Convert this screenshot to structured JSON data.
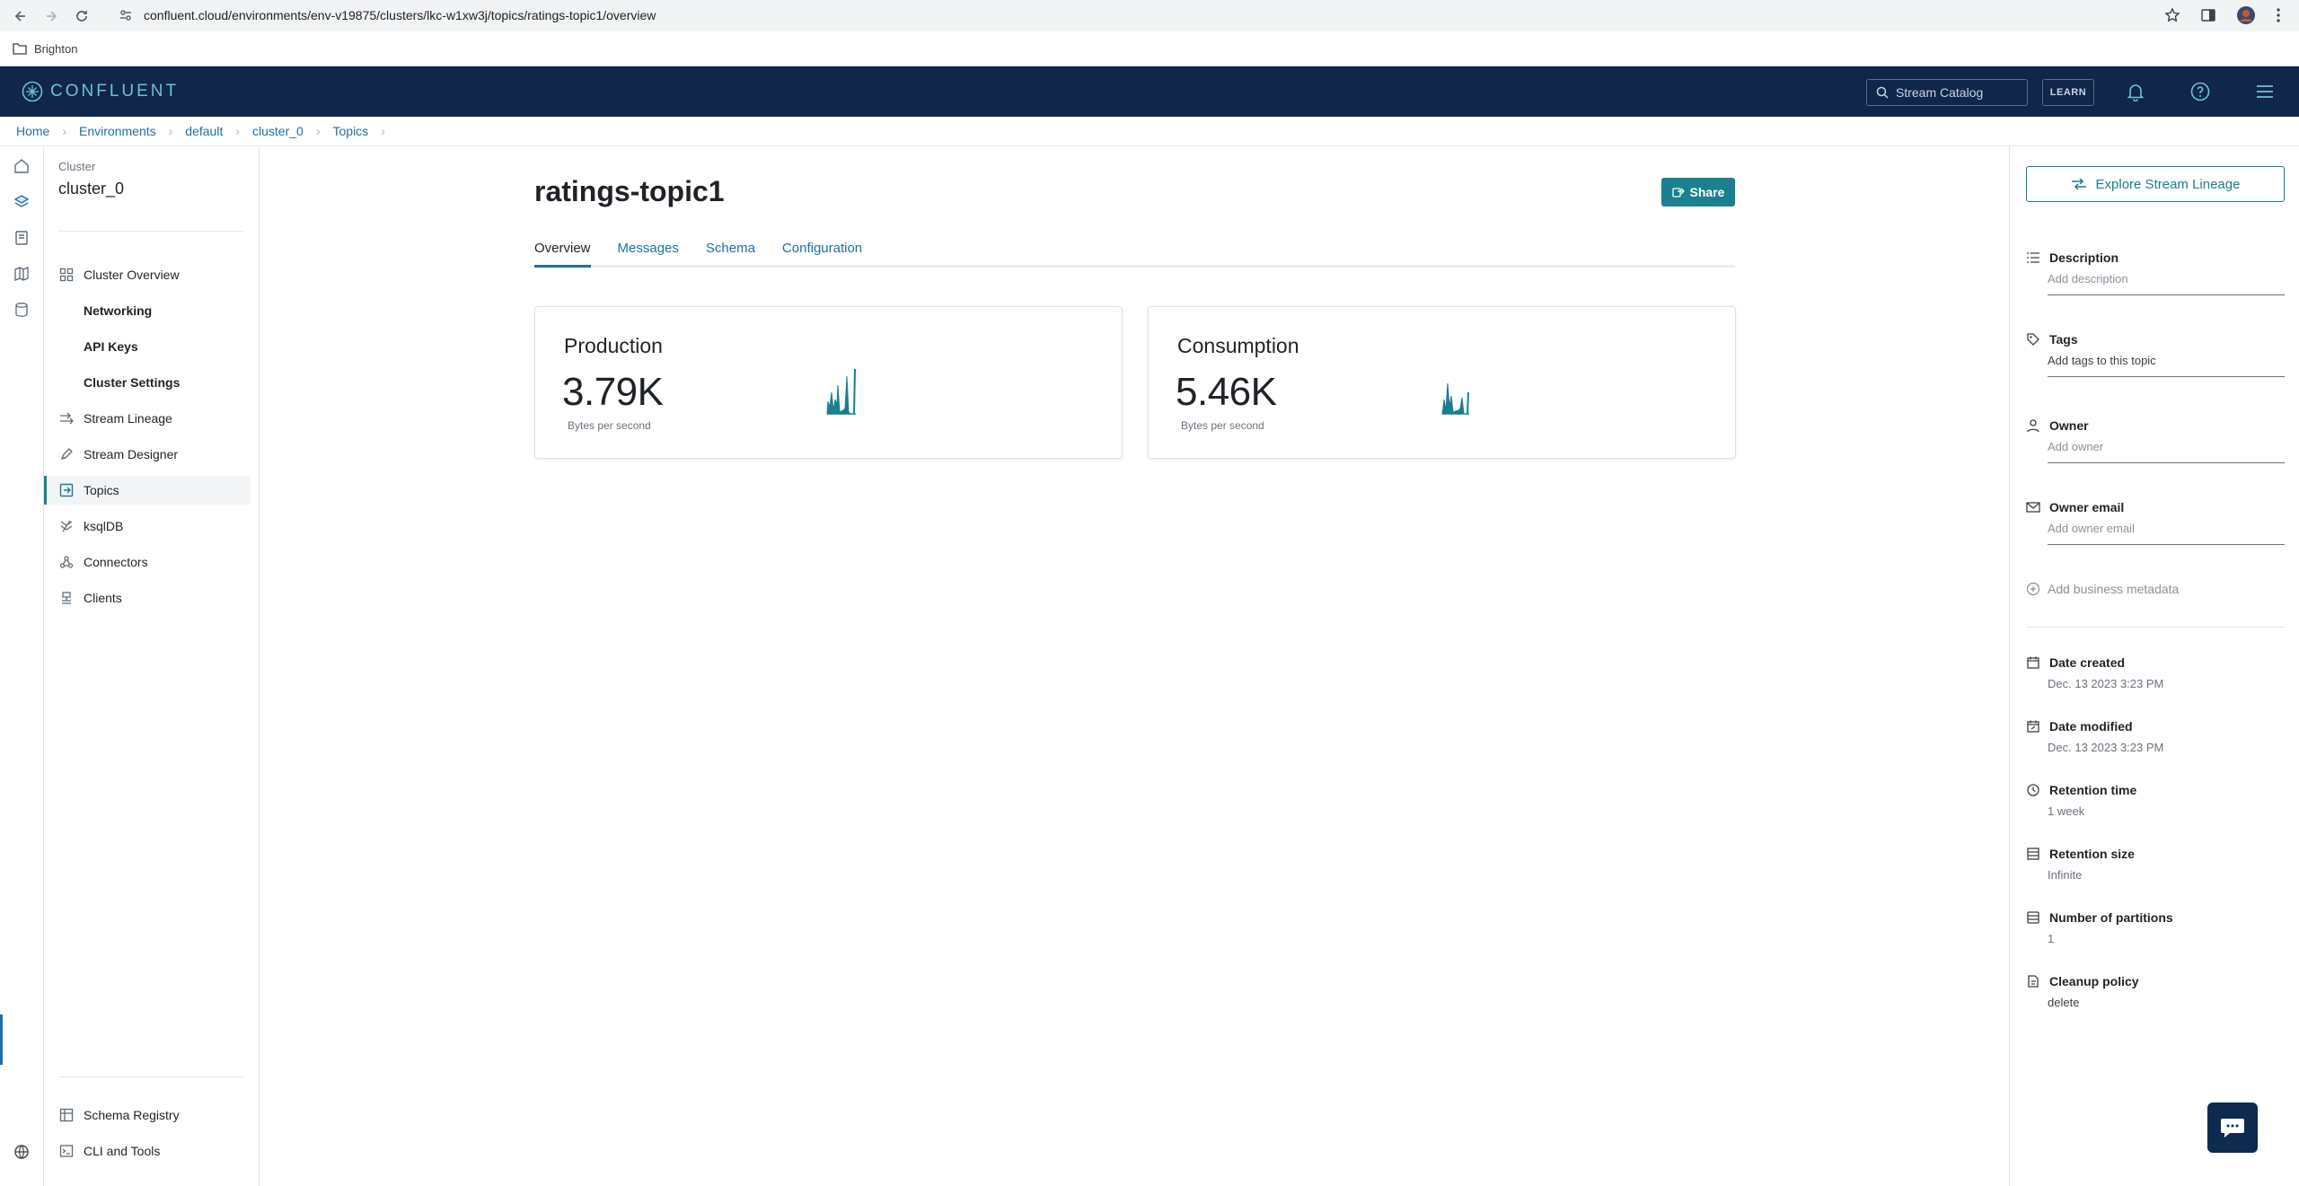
{
  "browser": {
    "url": "confluent.cloud/environments/env-v19875/clusters/lkc-w1xw3j/topics/ratings-topic1/overview",
    "bookmark": "Brighton"
  },
  "header": {
    "logo_text": "CONFLUENT",
    "search_placeholder": "Stream Catalog",
    "learn_label": "LEARN"
  },
  "breadcrumb": [
    "Home",
    "Environments",
    "default",
    "cluster_0",
    "Topics"
  ],
  "sidebar": {
    "eyebrow": "Cluster",
    "title": "cluster_0",
    "items": [
      {
        "label": "Cluster Overview"
      },
      {
        "label": "Networking"
      },
      {
        "label": "API Keys"
      },
      {
        "label": "Cluster Settings"
      },
      {
        "label": "Stream Lineage"
      },
      {
        "label": "Stream Designer"
      },
      {
        "label": "Topics"
      },
      {
        "label": "ksqlDB"
      },
      {
        "label": "Connectors"
      },
      {
        "label": "Clients"
      }
    ],
    "bottom_items": [
      {
        "label": "Schema Registry"
      },
      {
        "label": "CLI and Tools"
      }
    ]
  },
  "main": {
    "title": "ratings-topic1",
    "share_label": "Share",
    "tabs": [
      "Overview",
      "Messages",
      "Schema",
      "Configuration"
    ],
    "cards": [
      {
        "title": "Production",
        "value": "3.79K",
        "unit": "Bytes per second"
      },
      {
        "title": "Consumption",
        "value": "5.46K",
        "unit": "Bytes per second"
      }
    ]
  },
  "right_panel": {
    "lineage_label": "Explore Stream Lineage",
    "description": {
      "label": "Description",
      "placeholder": "Add description"
    },
    "tags": {
      "label": "Tags",
      "placeholder": "Add tags to this topic"
    },
    "owner": {
      "label": "Owner",
      "placeholder": "Add owner"
    },
    "owner_email": {
      "label": "Owner email",
      "placeholder": "Add owner email"
    },
    "add_business_metadata": "Add business metadata",
    "date_created": {
      "label": "Date created",
      "value": "Dec. 13 2023 3:23 PM"
    },
    "date_modified": {
      "label": "Date modified",
      "value": "Dec. 13 2023 3:23 PM"
    },
    "retention_time": {
      "label": "Retention time",
      "value": "1 week"
    },
    "retention_size": {
      "label": "Retention size",
      "value": "Infinite"
    },
    "partitions": {
      "label": "Number of partitions",
      "value": "1"
    },
    "cleanup_policy": {
      "label": "Cleanup policy",
      "value": "delete"
    }
  },
  "colors": {
    "header_bg": "#10264a",
    "accent": "#1a7f8e",
    "link": "#1e6fa8"
  }
}
